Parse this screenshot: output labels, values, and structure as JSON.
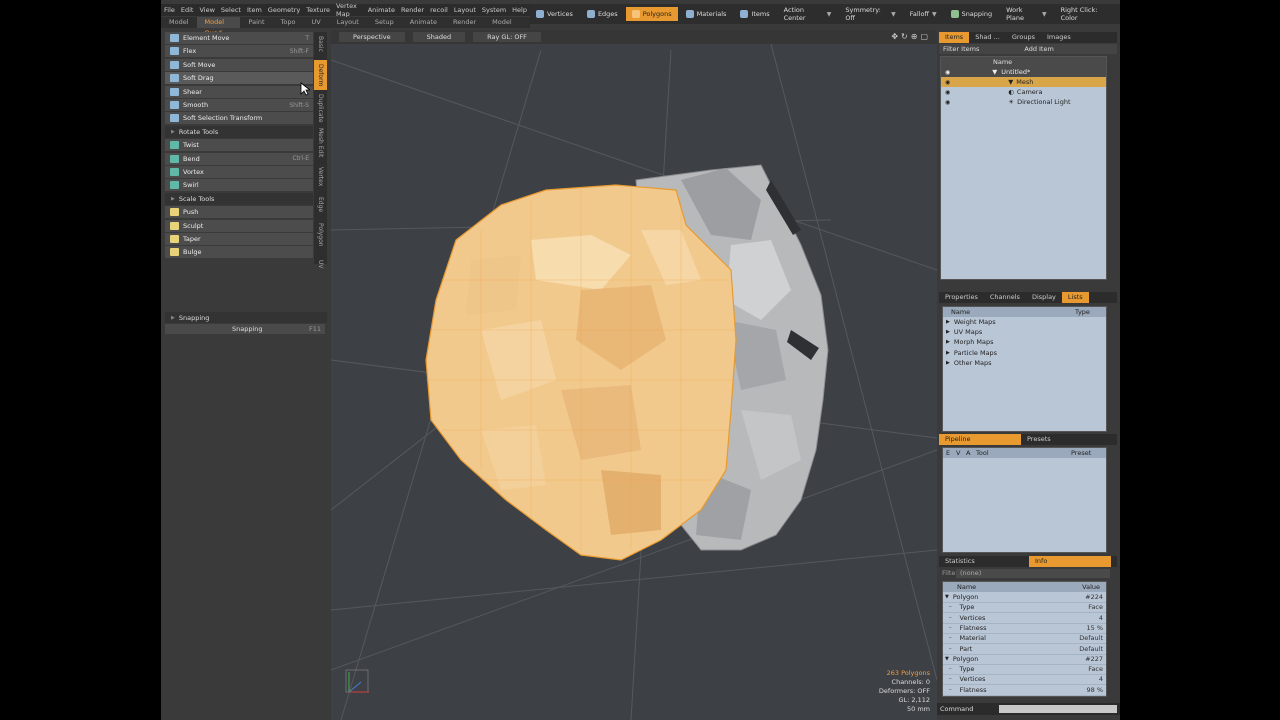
{
  "menu": [
    "File",
    "Edit",
    "View",
    "Select",
    "Item",
    "Geometry",
    "Texture",
    "Vertex Map",
    "Animate",
    "Render",
    "recoil",
    "Layout",
    "System",
    "Help"
  ],
  "layout_tabs": [
    "Model",
    "Model Quad",
    "Paint",
    "Topo",
    "UV",
    "Layout",
    "Setup",
    "Animate",
    "Render",
    "Model Single"
  ],
  "layout_tab_active": "Model Quad",
  "toolbar": {
    "vertices": "Vertices",
    "edges": "Edges",
    "polygons": "Polygons",
    "materials": "Materials",
    "items": "Items",
    "action_center": "Action Center",
    "symmetry": "Symmetry: Off",
    "falloff": "Falloff",
    "snapping": "Snapping",
    "work_plane": "Work Plane",
    "right_click": "Right Click: Color"
  },
  "tools": {
    "deform": [
      {
        "label": "Element Move",
        "shortcut": "T"
      },
      {
        "label": "Flex",
        "shortcut": "Shift-F"
      },
      {
        "label": "Soft Move",
        "shortcut": ""
      },
      {
        "label": "Soft Drag",
        "shortcut": ""
      },
      {
        "label": "Shear",
        "shortcut": ""
      },
      {
        "label": "Smooth",
        "shortcut": "Shift-S"
      },
      {
        "label": "Soft Selection Transform",
        "shortcut": ""
      }
    ],
    "rotate_header": "Rotate Tools",
    "rotate": [
      {
        "label": "Twist",
        "shortcut": ""
      },
      {
        "label": "Bend",
        "shortcut": "Ctrl-E"
      },
      {
        "label": "Vortex",
        "shortcut": ""
      },
      {
        "label": "Swirl",
        "shortcut": ""
      }
    ],
    "scale_header": "Scale Tools",
    "scale": [
      {
        "label": "Push",
        "shortcut": ""
      },
      {
        "label": "Sculpt",
        "shortcut": ""
      },
      {
        "label": "Taper",
        "shortcut": ""
      },
      {
        "label": "Bulge",
        "shortcut": ""
      }
    ]
  },
  "vtabs": [
    "Basic",
    "Deform",
    "Duplicate",
    "Mesh Edit",
    "Vertex",
    "Edge",
    "Polygon",
    "UV"
  ],
  "vtab_active": "Deform",
  "snapping": {
    "header": "Snapping",
    "button": "Snapping",
    "shortcut": "F11"
  },
  "viewport": {
    "view": "Perspective",
    "shading": "Shaded",
    "raygl": "Ray GL: OFF",
    "stats": {
      "polygons": "263 Polygons",
      "channels": "Channels: 0",
      "deformers": "Deformers: OFF",
      "gl": "GL: 2,112",
      "scale": "50 mm"
    }
  },
  "items_panel": {
    "tabs": [
      "Items",
      "Shad ...",
      "Groups",
      "Images"
    ],
    "filter": "Filter Items",
    "add": "Add Item",
    "name_col": "Name",
    "tree": [
      {
        "label": "Untitled*"
      },
      {
        "label": "Mesh"
      },
      {
        "label": "Camera"
      },
      {
        "label": "Directional Light"
      }
    ]
  },
  "lists_panel": {
    "tabs": [
      "Properties",
      "Channels",
      "Display",
      "Lists"
    ],
    "cols": [
      "Name",
      "Type"
    ],
    "rows": [
      "Weight Maps",
      "UV Maps",
      "Morph Maps",
      "Particle Maps",
      "Other Maps"
    ]
  },
  "pipeline_panel": {
    "tabs": [
      "Pipeline",
      "Presets"
    ],
    "cols": [
      "E",
      "V",
      "A",
      "Tool",
      "Preset"
    ]
  },
  "stats_panel": {
    "tabs": [
      "Statistics",
      "Info"
    ],
    "filter_label": "Filter",
    "filter_value": "(none)",
    "cols": [
      "Name",
      "Value"
    ],
    "rows": [
      {
        "name": "Polygon",
        "value": "#224",
        "group": true
      },
      {
        "name": "Type",
        "value": "Face"
      },
      {
        "name": "Vertices",
        "value": "4"
      },
      {
        "name": "Flatness",
        "value": "15 %"
      },
      {
        "name": "Material",
        "value": "Default"
      },
      {
        "name": "Part",
        "value": "Default"
      },
      {
        "name": "Polygon",
        "value": "#227",
        "group": true
      },
      {
        "name": "Type",
        "value": "Face"
      },
      {
        "name": "Vertices",
        "value": "4"
      },
      {
        "name": "Flatness",
        "value": "98 %"
      }
    ]
  },
  "command": {
    "label": "Command"
  }
}
